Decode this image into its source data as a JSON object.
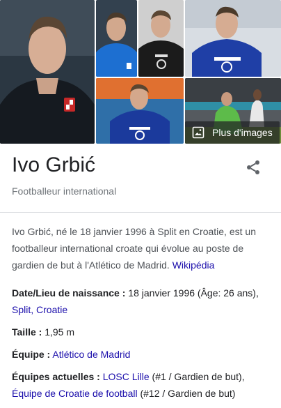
{
  "panel": {
    "title": "Ivo Grbić",
    "subtitle": "Footballeur international",
    "share_icon": "share-icon",
    "more_images_label": "Plus d'images",
    "more_images_icon": "image-icon",
    "description": "Ivo Grbić, né le 18 janvier 1996 à Split en Croatie, est un footballeur international croate qui évolue au poste de gardien de but à l'Atlético de Madrid.",
    "source_link": "Wikipédia"
  },
  "facts": {
    "birth": {
      "label": "Date/Lieu de naissance :",
      "value": "18 janvier 1996 (Âge: 26 ans),",
      "link": "Split, Croatie"
    },
    "height": {
      "label": "Taille :",
      "value": "1,95 m"
    },
    "team": {
      "label": "Équipe :",
      "link": "Atlético de Madrid"
    },
    "current_teams": {
      "label": "Équipes actuelles :",
      "link1": "LOSC Lille",
      "suffix1": "(#1 / Gardien de but),",
      "link2": "Équipe de Croatie de football",
      "suffix2": "(#12 / Gardien de but)"
    }
  },
  "colors": {
    "link": "#1a0dab",
    "text": "#202124",
    "muted": "#70757a",
    "divider": "#dadce0"
  }
}
